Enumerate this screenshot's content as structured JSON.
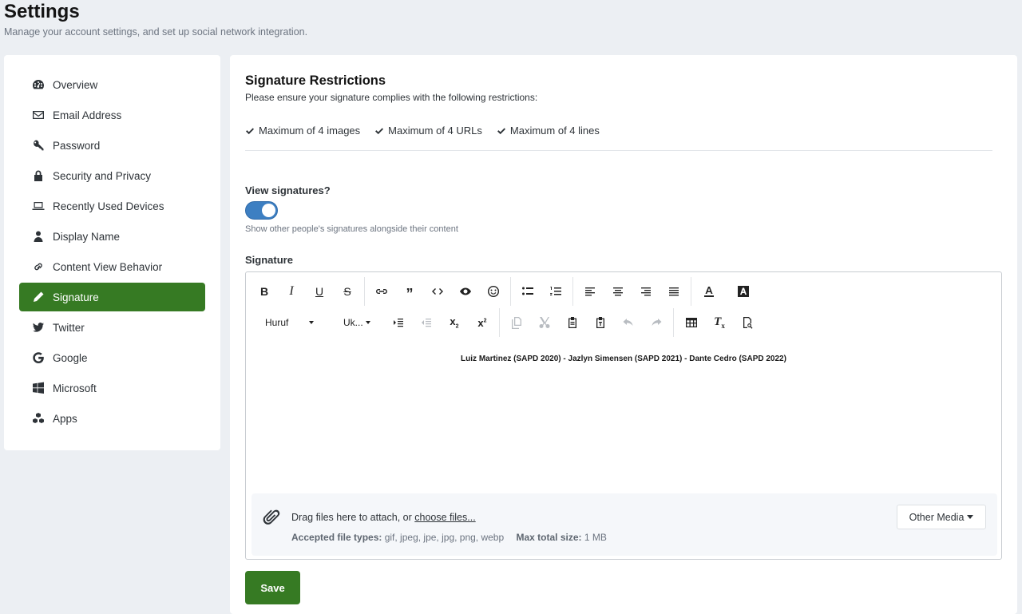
{
  "header": {
    "title": "Settings",
    "subtitle": "Manage your account settings, and set up social network integration."
  },
  "sidebar": {
    "items": [
      {
        "label": "Overview",
        "icon": "dashboard-icon"
      },
      {
        "label": "Email Address",
        "icon": "envelope-icon"
      },
      {
        "label": "Password",
        "icon": "key-icon"
      },
      {
        "label": "Security and Privacy",
        "icon": "lock-icon"
      },
      {
        "label": "Recently Used Devices",
        "icon": "laptop-icon"
      },
      {
        "label": "Display Name",
        "icon": "user-icon"
      },
      {
        "label": "Content View Behavior",
        "icon": "link-icon"
      },
      {
        "label": "Signature",
        "icon": "pencil-icon",
        "active": true
      },
      {
        "label": "Twitter",
        "icon": "twitter-icon"
      },
      {
        "label": "Google",
        "icon": "google-icon"
      },
      {
        "label": "Microsoft",
        "icon": "windows-icon"
      },
      {
        "label": "Apps",
        "icon": "cubes-icon"
      }
    ]
  },
  "restrictions": {
    "title": "Signature Restrictions",
    "description": "Please ensure your signature complies with the following restrictions:",
    "items": [
      "Maximum of 4 images",
      "Maximum of 4 URLs",
      "Maximum of 4 lines"
    ]
  },
  "view_signatures": {
    "label": "View signatures?",
    "enabled": true,
    "help": "Show other people's signatures alongside their content"
  },
  "signature": {
    "label": "Signature",
    "toolbar": {
      "font_dropdown": "Huruf",
      "size_dropdown": "Uk..."
    },
    "content": "Luiz Martinez (SAPD 2020) - Jazlyn Simensen (SAPD 2021) - Dante Cedro (SAPD 2022)"
  },
  "attach": {
    "drag_text": "Drag files here to attach, or ",
    "choose_link": "choose files...",
    "accepted_label": "Accepted file types:",
    "accepted_types": "gif, jpeg, jpe, jpg, png, webp",
    "max_label": "Max total size:",
    "max_size": "1 MB",
    "other_media": "Other Media"
  },
  "actions": {
    "save": "Save"
  },
  "colors": {
    "accent": "#367a23",
    "toggle_on": "#3d7fc2"
  }
}
